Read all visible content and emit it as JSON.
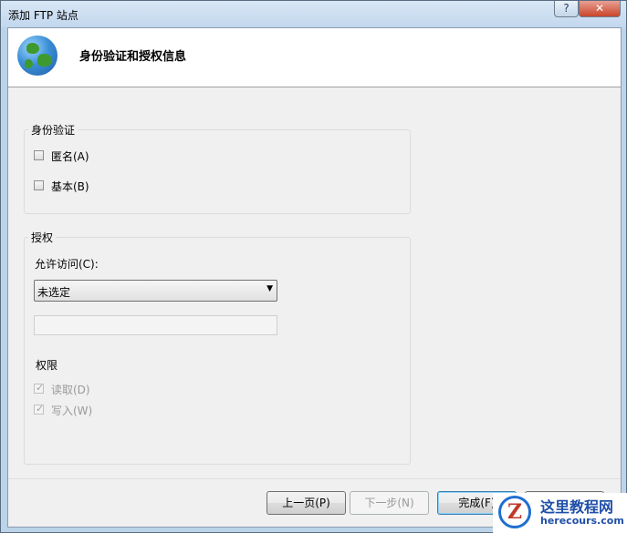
{
  "window": {
    "title": "添加 FTP 站点",
    "help_glyph": "?",
    "close_glyph": "✕"
  },
  "header": {
    "title": "身份验证和授权信息",
    "icon": "globe-icon"
  },
  "authentication": {
    "group_title": "身份验证",
    "anonymous": {
      "label": "匿名(A)",
      "checked": false
    },
    "basic": {
      "label": "基本(B)",
      "checked": false
    }
  },
  "authorization": {
    "group_title": "授权",
    "allow_access_label": "允许访问(C):",
    "allow_access_value": "未选定",
    "users_input_value": "",
    "permissions_title": "权限",
    "read": {
      "label": "读取(D)",
      "checked": true,
      "enabled": false
    },
    "write": {
      "label": "写入(W)",
      "checked": true,
      "enabled": false
    }
  },
  "buttons": {
    "previous": "上一页(P)",
    "next": "下一步(N)",
    "finish": "完成(F)"
  },
  "watermark": {
    "name": "这里教程网",
    "url": "herecours.com"
  }
}
